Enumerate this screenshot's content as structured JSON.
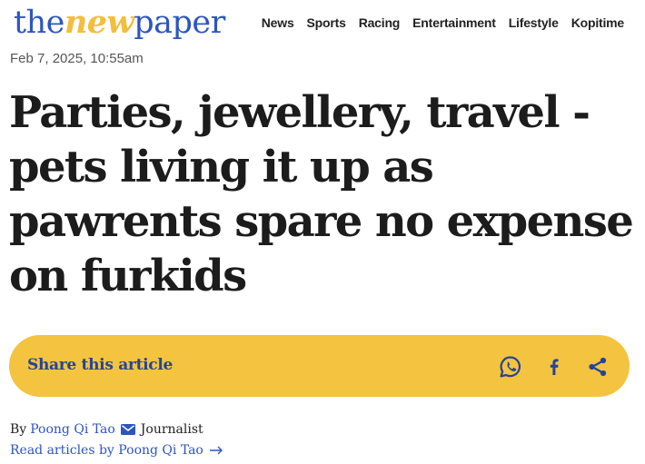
{
  "site": {
    "logo_part1": "the",
    "logo_part2": "new",
    "logo_part3": "paper",
    "logo_colors": {
      "blue": "#2d55bf",
      "yellow": "#f2be3d"
    }
  },
  "nav": {
    "items": [
      "News",
      "Sports",
      "Racing",
      "Entertainment",
      "Lifestyle",
      "Kopitime"
    ]
  },
  "article": {
    "date": "Feb 7, 2025, 10:55am",
    "headline": "Parties, jewellery, travel - pets living it up as pawrents spare no expense on furkids"
  },
  "share": {
    "label": "Share this article",
    "bar_color": "#f4c33f",
    "icons": [
      "whatsapp-icon",
      "facebook-icon",
      "share-icon"
    ]
  },
  "byline": {
    "by": "By",
    "author": "Poong Qi Tao",
    "role": "Journalist",
    "more_link": "Read articles by Poong Qi Tao"
  }
}
